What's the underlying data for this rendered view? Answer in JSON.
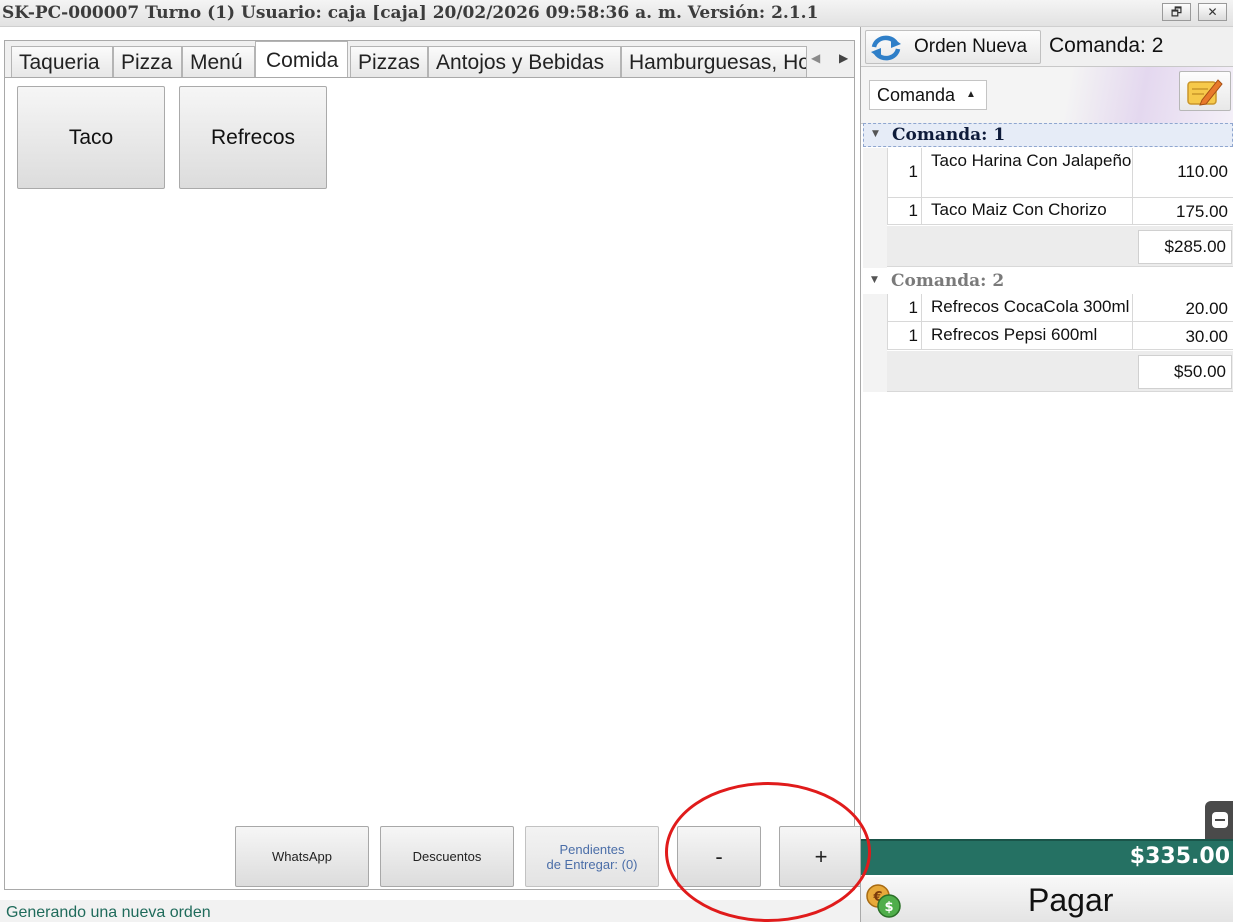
{
  "window": {
    "title": "SK-PC-000007 Turno (1) Usuario: caja [caja] 20/02/2026 09:58:36 a. m. Versión: 2.1.1",
    "restore_glyph": "🗗",
    "close_glyph": "✕"
  },
  "tabs": [
    {
      "label": "Taqueria",
      "active": false
    },
    {
      "label": "Pizza",
      "active": false
    },
    {
      "label": "Menú",
      "active": false
    },
    {
      "label": "Comida",
      "active": true
    },
    {
      "label": "Pizzas",
      "active": false
    },
    {
      "label": "Antojos y Bebidas",
      "active": false
    },
    {
      "label": "Hamburguesas, Ho",
      "active": false
    }
  ],
  "tab_scroll": {
    "left": "◀",
    "right": "▶"
  },
  "products": [
    {
      "label": "Taco"
    },
    {
      "label": "Refrecos"
    }
  ],
  "actions": {
    "whatsapp": "WhatsApp",
    "descuentos": "Descuentos",
    "pendientes_line1": "Pendientes",
    "pendientes_line2": "de Entregar: (0)",
    "minus": "-",
    "plus": "+"
  },
  "status": {
    "text": "Generando una nueva orden"
  },
  "order_panel": {
    "orden_nueva_label": "Orden Nueva",
    "comanda_current": "Comanda: 2",
    "dropdown_value": "Comanda",
    "dropdown_arrow": "▲",
    "groups": [
      {
        "label": "Comanda: 1",
        "arrow": "▼",
        "items": [
          {
            "qty": "1",
            "name": "Taco Harina Con Jalapeño",
            "price": "110.00"
          },
          {
            "qty": "1",
            "name": "Taco Maiz Con Chorizo",
            "price": "175.00"
          }
        ],
        "subtotal": "$285.00"
      },
      {
        "label": "Comanda: 2",
        "arrow": "▼",
        "items": [
          {
            "qty": "1",
            "name": "Refrecos CocaCola 300ml",
            "price": "20.00"
          },
          {
            "qty": "1",
            "name": "Refrecos Pepsi 600ml",
            "price": "30.00"
          }
        ],
        "subtotal": "$50.00"
      }
    ],
    "total": "$335.00",
    "pay_label": "Pagar"
  },
  "colors": {
    "total_bar": "#257163",
    "annotation_circle": "#e01b1b",
    "status_text": "#1f6b5b"
  },
  "icons": [
    "refresh-icon",
    "notes-icon",
    "money-icon",
    "side-handle-icon"
  ]
}
